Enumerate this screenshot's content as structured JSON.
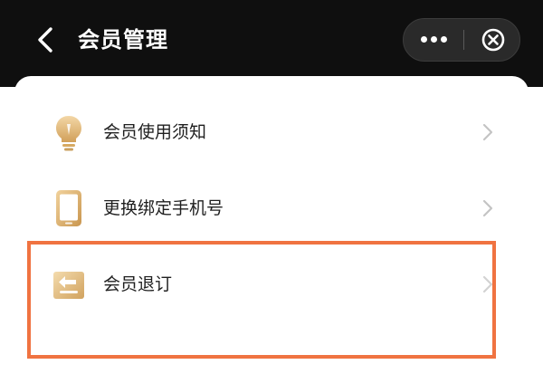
{
  "header": {
    "title": "会员管理",
    "back_icon": "chevron-left-icon",
    "more_icon": "more-dots-icon",
    "close_icon": "close-circle-icon"
  },
  "menu": {
    "items": [
      {
        "label": "会员使用须知",
        "icon": "lightbulb-icon"
      },
      {
        "label": "更换绑定手机号",
        "icon": "phone-icon"
      },
      {
        "label": "会员退订",
        "icon": "return-icon"
      }
    ]
  },
  "colors": {
    "header_bg": "#0f0f0f",
    "accent_gold": "#d4a55e",
    "highlight": "#f07341",
    "chevron": "#bdbdbd",
    "text": "#1f1f1f"
  }
}
